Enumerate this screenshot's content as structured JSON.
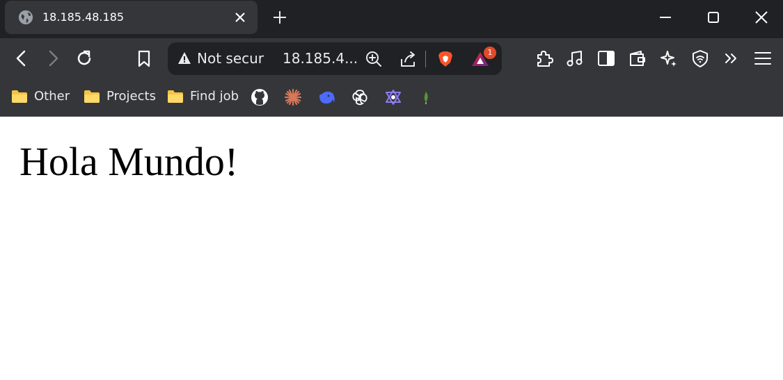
{
  "tab": {
    "title": "18.185.48.185",
    "favicon_icon": "globe-icon"
  },
  "omnibox": {
    "security_label": "Not secure",
    "url_display": "18.185.4...",
    "shields_badge": "1"
  },
  "bookmarks": {
    "folders": [
      {
        "label": "Other",
        "icon": "folder-icon"
      },
      {
        "label": "Projects",
        "icon": "folder-icon"
      },
      {
        "label": "Find job",
        "icon": "folder-icon"
      }
    ],
    "shortcuts": [
      "github-icon",
      "claude-icon",
      "deepseek-icon",
      "chatgpt-icon",
      "perplexity-icon",
      "mongodb-icon"
    ]
  },
  "page": {
    "heading": "Hola Mundo!"
  },
  "colors": {
    "titlebar": "#202124",
    "toolbar": "#35363a",
    "omnibox": "#202124",
    "text": "#e8eaed",
    "brave_orange": "#fb542b",
    "folder_yellow": "#f6c343"
  }
}
